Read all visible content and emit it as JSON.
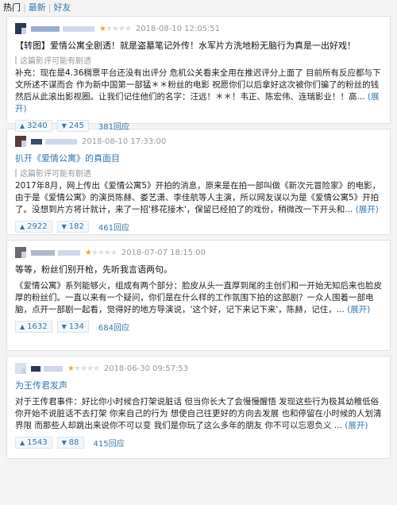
{
  "tabs": [
    {
      "label": "热门",
      "active": true
    },
    {
      "label": "最新",
      "active": false
    },
    {
      "label": "好友",
      "active": false
    }
  ],
  "spoiler_text": "这篇影评可能有剧透",
  "more_label": "(展开)",
  "reviews": [
    {
      "rating": 1,
      "time": "2018-08-10 12:05:51",
      "title": "【转图】爱情公寓全剧透！就是盗墓笔记外传！水军片方洗地粉无脑行为真是一出好戏！",
      "body": "补充：现在是4.36稠票平台还没有出评分 危机公关看来全用在推迟评分上面了 目前所有反应都与下文所述不谋而合 作为新中国第一部猛＊＊粉丝的电影 祝愿你们以后拿好这次被你们骗了的粉丝的钱 然后从此滚出影视圈。让我们记住他们的名字：汪远！＊＊！韦正、陈宏伟、连瑞影业！！高...",
      "up": "3240",
      "down": "245",
      "replies": "381回应"
    },
    {
      "rating": 0,
      "time": "2018-08-10 17:33:00",
      "title": "扒开《爱情公寓》的真面目",
      "body": "2017年8月，网上传出《爱情公寓5》开拍的消息，原来是在拍一部叫做《新次元冒险家》的电影，由于是《爱情公寓》的演员陈赫、娄艺潇、李佳航等人主演，所以网友误以为是《爱情公寓5》开拍了。没想到片方将计就计，来了一招'移花接木'，保留已经拍了的戏份，稍微改一下开头和...",
      "up": "2922",
      "down": "182",
      "replies": "461回应"
    },
    {
      "rating": 1,
      "time": "2018-07-07 18:15:00",
      "title": "等等，粉丝们别开枪，先听我言语两句。",
      "body": "《爱情公寓》系列能够火，组成有两个部分：脸皮从头一直厚到尾的主创们和一开始无知后来也脸皮厚的粉丝们。一直以来有一个疑问，你们是在什么样的工作氛围下拍的这部剧？一众人围着一部电脑，点开一部剧一起看，觉得好的地方导演说，'这个好，记下来记下来'，陈赫，记住，...",
      "up": "1632",
      "down": "134",
      "replies": "684回应"
    },
    {
      "rating": 1,
      "time": "2018-06-30 09:57:53",
      "title": "为王传君发声",
      "body": "对于王传君事件：好比你小时候合打架说脏话 但当你长大了会慢慢醒悟 发现这些行为极其幼稚低俗 你开始不说脏话不去打架 你来自己的行为 想使自己往更好的方向去发展 也和停留在小时候的人划清界限 而那些人却跳出来说你不可以变 我们是你玩了这么多年的朋友 你不可以忘恩负义 ...",
      "up": "1543",
      "down": "88",
      "replies": "415回应"
    }
  ]
}
